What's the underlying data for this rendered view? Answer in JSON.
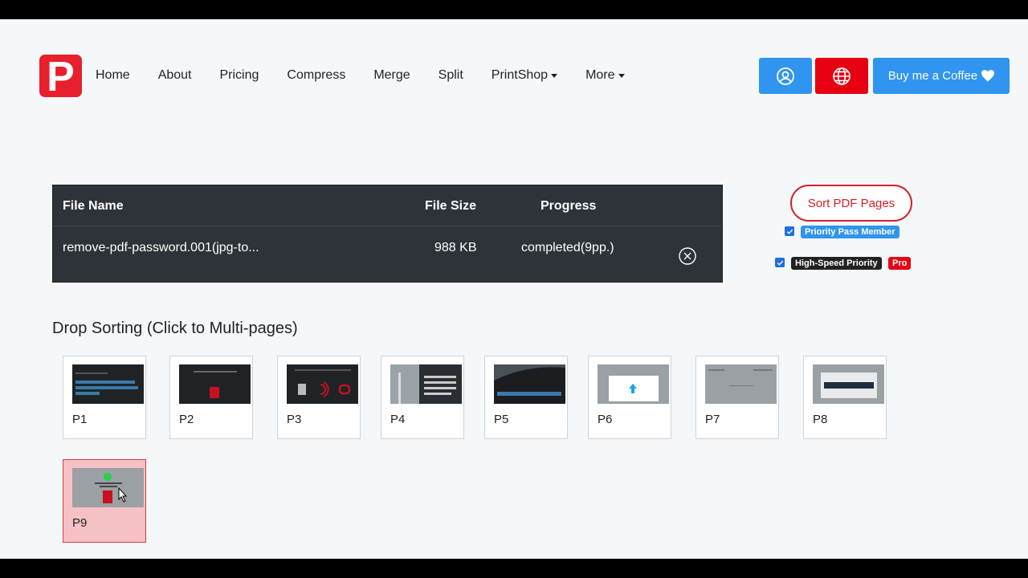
{
  "brand": {
    "logo_letter": "P",
    "color": "#e8202e"
  },
  "nav": {
    "items": [
      {
        "label": "Home"
      },
      {
        "label": "About"
      },
      {
        "label": "Pricing"
      },
      {
        "label": "Compress"
      },
      {
        "label": "Merge"
      },
      {
        "label": "Split"
      },
      {
        "label": "PrintShop",
        "dropdown": true
      },
      {
        "label": "More",
        "dropdown": true
      }
    ]
  },
  "header_buttons": {
    "account_icon": "user-icon",
    "language_icon": "globe-icon",
    "coffee_label": "Buy me a Coffee",
    "coffee_icon": "heart-icon"
  },
  "file_table": {
    "columns": [
      "File Name",
      "File Size",
      "Progress"
    ],
    "rows": [
      {
        "name": "remove-pdf-password.001(jpg-to...",
        "size": "988 KB",
        "progress": "completed(9pp.)",
        "remove_icon": "close-circle-icon"
      }
    ]
  },
  "side": {
    "sort_button": "Sort PDF Pages",
    "options": [
      {
        "checked": true,
        "label": "Priority Pass Member",
        "color": "#2f95f0"
      },
      {
        "checked": true,
        "label": "High-Speed Priority",
        "color": "#222222",
        "extra_badge": "Pro",
        "extra_color": "#e60012"
      }
    ]
  },
  "sorting": {
    "title": "Drop Sorting (Click to Multi-pages)",
    "pages": [
      {
        "label": "P1",
        "selected": false
      },
      {
        "label": "P2",
        "selected": false
      },
      {
        "label": "P3",
        "selected": false
      },
      {
        "label": "P4",
        "selected": false
      },
      {
        "label": "P5",
        "selected": false
      },
      {
        "label": "P6",
        "selected": false
      },
      {
        "label": "P7",
        "selected": false
      },
      {
        "label": "P8",
        "selected": false
      },
      {
        "label": "P9",
        "selected": true
      }
    ]
  }
}
